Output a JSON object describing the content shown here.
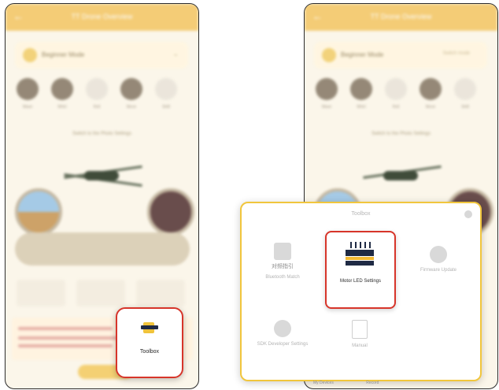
{
  "screen_title": "TT Drone Overview",
  "back_icon": "back-arrow-icon",
  "mode": {
    "label": "Beginner Mode",
    "right_text": "Switch mode"
  },
  "quick_actions": [
    "Wave",
    "Whirl",
    "Roll",
    "Move",
    "Shift"
  ],
  "link_text": "Switch to the Photo Settings",
  "toolbox_button": {
    "label": "Toolbox",
    "icon": "toolbox-icon"
  },
  "toolbox_panel": {
    "title": "Toolbox",
    "tools": [
      {
        "label_cn": "对频指引",
        "label": "Bluetooth Match",
        "icon": "pairing-icon"
      },
      {
        "label": "Motor LED Settings",
        "icon": "led-lightbar-icon"
      },
      {
        "label": "Firmware Update",
        "icon": "settings-icon"
      },
      {
        "label": "SDK Developer Settings",
        "icon": "sdk-icon"
      },
      {
        "label": "Manual",
        "icon": "document-icon"
      }
    ]
  },
  "bottom_tabs": [
    "My Devices",
    "Record"
  ],
  "colors": {
    "accent": "#f3c86a",
    "highlight": "#d7352a",
    "panel_border": "#f1c63d"
  }
}
